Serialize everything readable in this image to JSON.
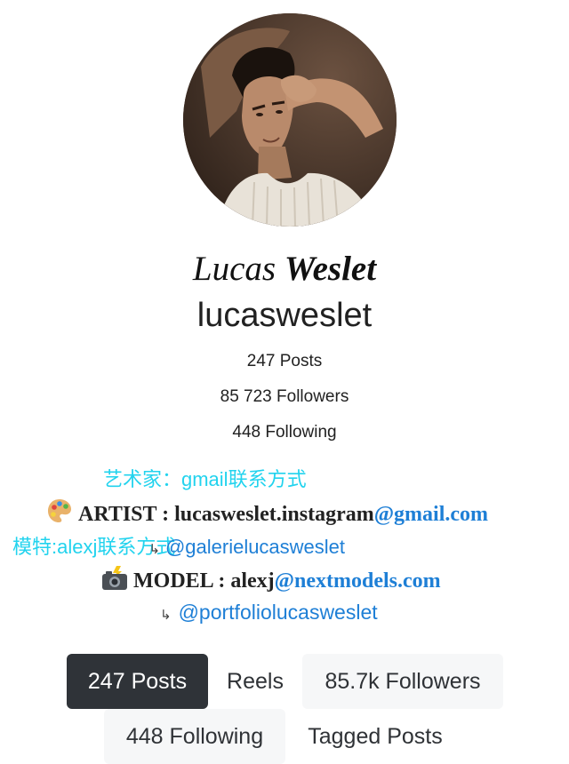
{
  "profile": {
    "display_name_regular": "Lucas ",
    "display_name_bold": "Weslet",
    "username": "lucasweslet",
    "avatar_icon": "profile-photo"
  },
  "stats": {
    "posts": "247 Posts",
    "followers": "85 723 Followers",
    "following": "448 Following"
  },
  "bio": {
    "line1": "艺术家：gmail联系方式",
    "artist_emoji": "palette-icon",
    "artist_label": "ARTIST : lucasweslet.instagram",
    "artist_link": "@gmail.com",
    "model_cn_prefix": "模特:alexj联系方式",
    "model_cn_arrow": "↳",
    "model_cn_link": "@galerielucasweslet",
    "model_emoji": "camera-flash-icon",
    "model_label": "MODEL : alexj",
    "model_link": "@nextmodels.com",
    "portfolio_arrow": "↳",
    "portfolio_link": "@portfoliolucasweslet"
  },
  "tabs": [
    {
      "label": "247 Posts",
      "active": true
    },
    {
      "label": "Reels",
      "active": false
    },
    {
      "label": "85.7k Followers",
      "active": false
    },
    {
      "label": "448 Following",
      "active": false
    },
    {
      "label": "Tagged Posts",
      "active": false
    }
  ],
  "colors": {
    "cyan_text": "#22d3ee",
    "link_blue": "#1e7fd6",
    "active_tab": "#2f3338",
    "inactive_tab": "#f6f7f8"
  }
}
